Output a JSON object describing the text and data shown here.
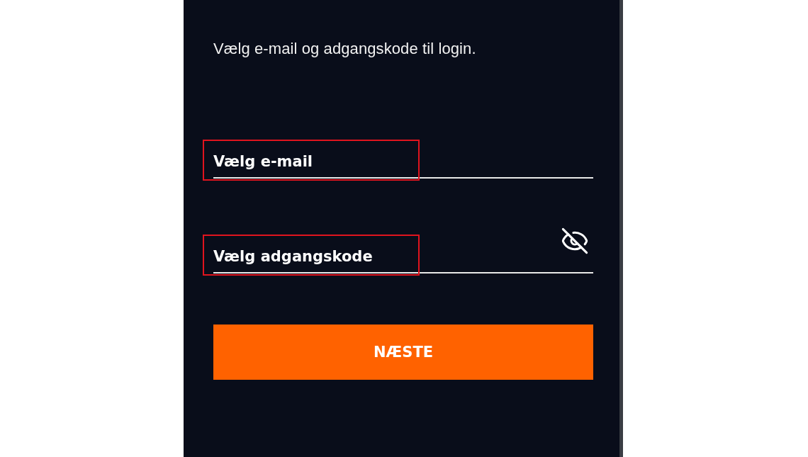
{
  "intro": "Vælg e-mail og adgangskode til login.",
  "fields": [
    {
      "kind": "email",
      "placeholder": "Vælg e-mail",
      "highlighted": true
    },
    {
      "kind": "password",
      "placeholder": "Vælg adgangskode",
      "highlighted": true
    }
  ],
  "button": "NÆSTE"
}
